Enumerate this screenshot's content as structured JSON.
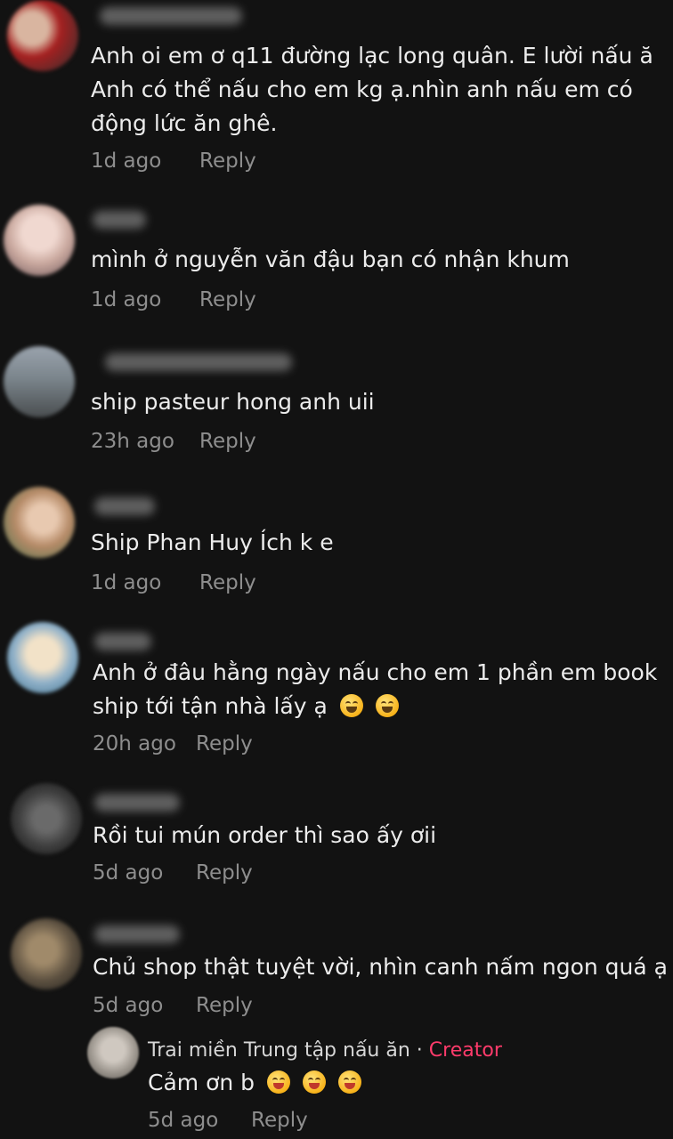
{
  "comments": [
    {
      "text1": "Anh oi em ơ q11 đường lạc long quân. E lười nấu ă",
      "text2": "Anh có thể nấu cho em kg ạ.nhìn anh nấu em có",
      "text3": "động lức ăn ghê.",
      "time": "1d ago",
      "reply": "Reply"
    },
    {
      "text1": "mình ở nguyễn văn đậu bạn có nhận khum",
      "time": "1d ago",
      "reply": "Reply"
    },
    {
      "text1": "ship pasteur hong anh uii",
      "time": "23h ago",
      "reply": "Reply"
    },
    {
      "text1": "Ship Phan Huy Ích k e",
      "time": "1d ago",
      "reply": "Reply"
    },
    {
      "text1": "Anh ở đâu hằng ngày nấu cho em 1 phần em book",
      "text2": "ship tới tận nhà lấy ạ",
      "time": "20h ago",
      "reply": "Reply"
    },
    {
      "text1": "Rồi tui mún order thì sao ấy ơii",
      "time": "5d ago",
      "reply": "Reply"
    },
    {
      "text1": "Chủ shop thật tuyệt vời, nhìn canh nấm ngon quá ạ",
      "time": "5d ago",
      "reply": "Reply"
    }
  ],
  "creator_reply": {
    "name": "Trai miền Trung tập nấu ăn",
    "separator": " · ",
    "badge": "Creator",
    "text": "Cảm ơn b",
    "time": "5d ago",
    "reply": "Reply"
  },
  "colors": {
    "background": "#121212",
    "text": "#ececec",
    "meta": "#8e8e8e",
    "creator_badge": "#ff3b6b"
  }
}
